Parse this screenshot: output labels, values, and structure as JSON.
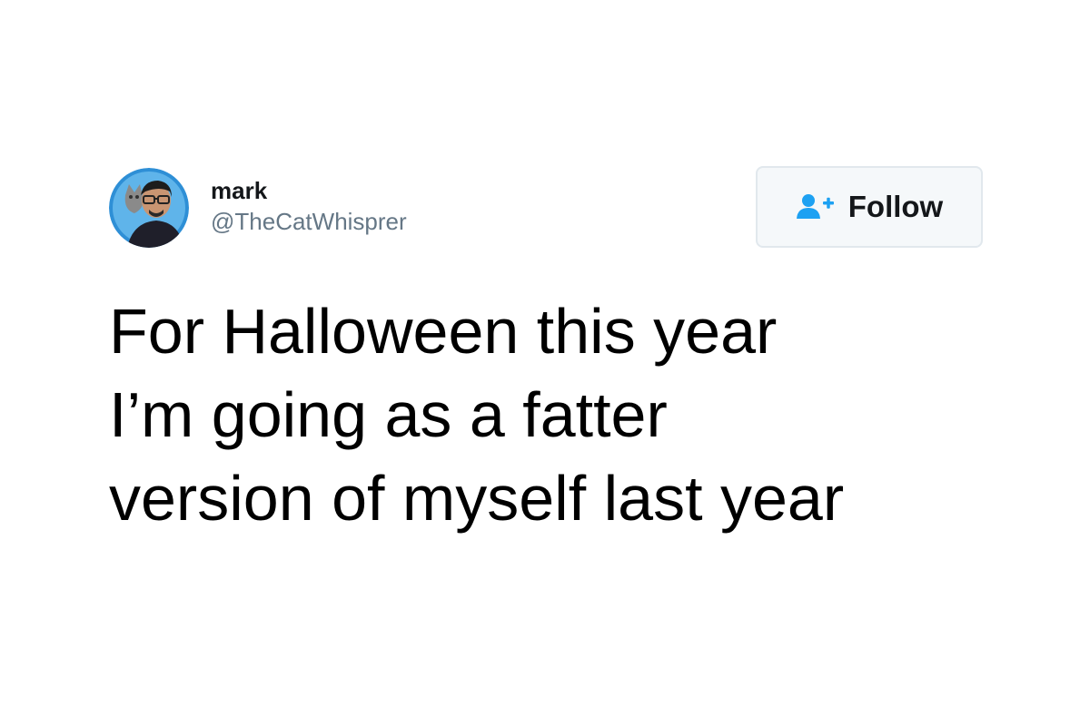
{
  "user": {
    "display_name": "mark",
    "handle": "@TheCatWhisprer",
    "avatar": "profile-photo"
  },
  "follow_button": {
    "label": "Follow",
    "icon": "add-user-icon",
    "accent_color": "#1da1f2"
  },
  "tweet": {
    "lines": [
      "For Halloween this year",
      "I’m going as a fatter",
      "version of myself last year"
    ]
  }
}
